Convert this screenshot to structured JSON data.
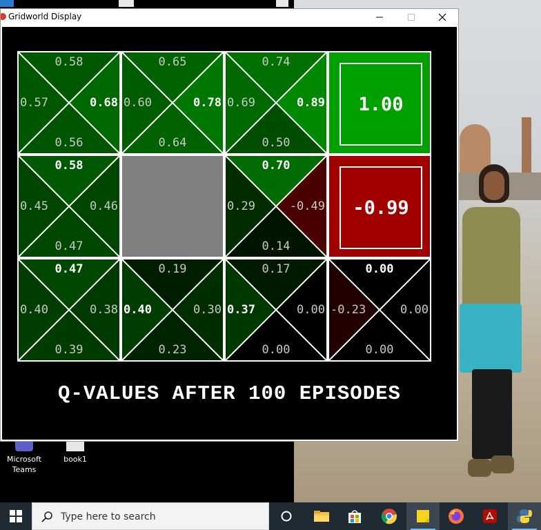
{
  "window": {
    "title": "Gridworld Display"
  },
  "gridworld": {
    "caption": "Q-VALUES AFTER 100 EPISODES",
    "cells": [
      {
        "row": 0,
        "col": 0,
        "type": "q",
        "n": "0.58",
        "e": "0.68",
        "s": "0.56",
        "w": "0.57",
        "best": "e"
      },
      {
        "row": 0,
        "col": 1,
        "type": "q",
        "n": "0.65",
        "e": "0.78",
        "s": "0.64",
        "w": "0.60",
        "best": "e"
      },
      {
        "row": 0,
        "col": 2,
        "type": "q",
        "n": "0.74",
        "e": "0.89",
        "s": "0.50",
        "w": "0.69",
        "best": "e"
      },
      {
        "row": 0,
        "col": 3,
        "type": "terminal",
        "value": "1.00",
        "color": "#00a000"
      },
      {
        "row": 1,
        "col": 0,
        "type": "q",
        "n": "0.58",
        "e": "0.46",
        "s": "0.47",
        "w": "0.45",
        "best": "n"
      },
      {
        "row": 1,
        "col": 1,
        "type": "wall",
        "color": "#808080"
      },
      {
        "row": 1,
        "col": 2,
        "type": "q",
        "n": "0.70",
        "e": "-0.49",
        "s": "0.14",
        "w": "0.29",
        "best": "n"
      },
      {
        "row": 1,
        "col": 3,
        "type": "terminal",
        "value": "-0.99",
        "color": "#a00000"
      },
      {
        "row": 2,
        "col": 0,
        "type": "q",
        "n": "0.47",
        "e": "0.38",
        "s": "0.39",
        "w": "0.40",
        "best": "n"
      },
      {
        "row": 2,
        "col": 1,
        "type": "q",
        "n": "0.19",
        "e": "0.30",
        "s": "0.23",
        "w": "0.40",
        "best": "w"
      },
      {
        "row": 2,
        "col": 2,
        "type": "q",
        "n": "0.17",
        "e": "0.00",
        "s": "0.00",
        "w": "0.37",
        "best": "w"
      },
      {
        "row": 2,
        "col": 3,
        "type": "q",
        "n": "0.00",
        "e": "0.00",
        "s": "0.00",
        "w": "-0.23",
        "best": "n"
      }
    ]
  },
  "desktop": {
    "icons": [
      {
        "label": "Microsoft Teams",
        "icon": "teams-icon"
      },
      {
        "label": "book1",
        "icon": "document-icon"
      }
    ]
  },
  "taskbar": {
    "search_placeholder": "Type here to search",
    "apps": [
      {
        "name": "task-view",
        "icon": "task-view-icon"
      },
      {
        "name": "file-explorer",
        "icon": "folder-icon"
      },
      {
        "name": "microsoft-store",
        "icon": "store-icon"
      },
      {
        "name": "chrome",
        "icon": "chrome-icon"
      },
      {
        "name": "sticky-notes",
        "icon": "sticky-note-icon"
      },
      {
        "name": "firefox",
        "icon": "firefox-icon"
      },
      {
        "name": "acrobat",
        "icon": "pdf-icon"
      },
      {
        "name": "python",
        "icon": "python-icon"
      }
    ]
  }
}
